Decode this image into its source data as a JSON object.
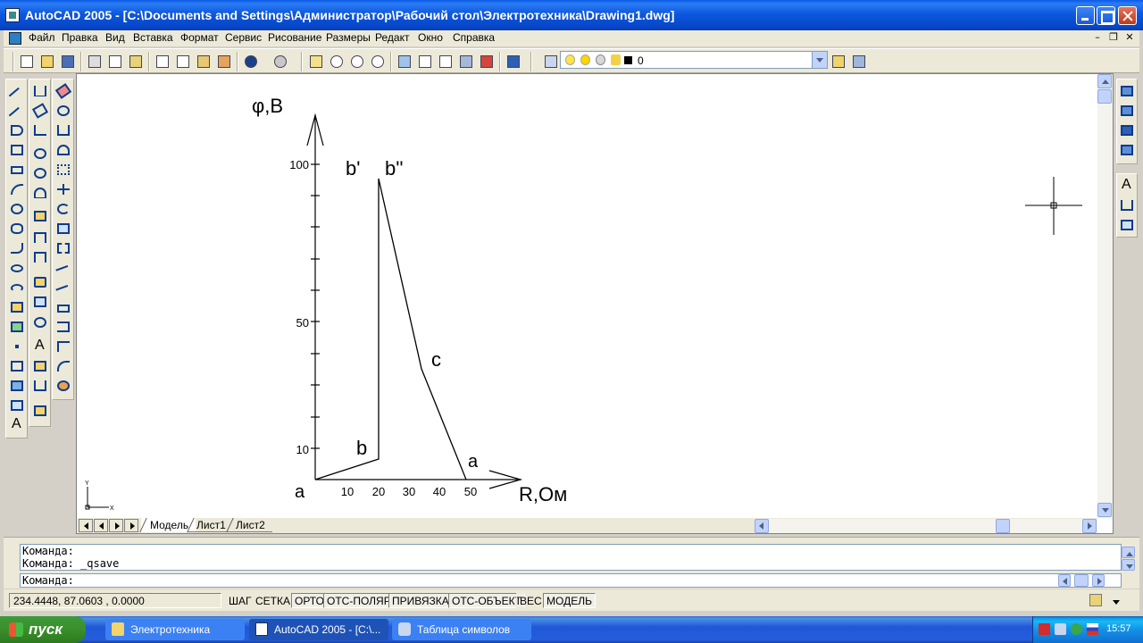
{
  "window": {
    "title": "AutoCAD 2005 - [C:\\Documents and Settings\\Администратор\\Рабочий стол\\Электротехника\\Drawing1.dwg]"
  },
  "menu": [
    "Файл",
    "Правка",
    "Вид",
    "Вставка",
    "Формат",
    "Сервис",
    "Рисование",
    "Размеры",
    "Редакт",
    "Окно",
    "Справка"
  ],
  "layer": {
    "current": "0"
  },
  "drawing": {
    "y_axis_label": "φ,B",
    "x_axis_label": "R,Ом",
    "y_ticks": [
      "100",
      "50",
      "10"
    ],
    "x_ticks": [
      "10",
      "20",
      "30",
      "40",
      "50"
    ],
    "origin_label": "a",
    "point_labels": [
      "b'",
      "b''",
      "c",
      "b",
      "a"
    ],
    "ucs": {
      "y": "Y",
      "x": "X"
    }
  },
  "tabs": [
    "Модель",
    "Лист1",
    "Лист2"
  ],
  "command": {
    "history": [
      "Команда:",
      "Команда: _qsave"
    ],
    "prompt": "Команда:"
  },
  "status": {
    "coords": "234.4448, 87.0603 , 0.0000",
    "toggles": [
      "ШАГ",
      "СЕТКА",
      "ОРТО",
      "ОТС-ПОЛЯР",
      "ПРИВЯЗКА",
      "ОТС-ОБЪЕКТ",
      "ВЕС",
      "МОДЕЛЬ"
    ]
  },
  "taskbar": {
    "start": "пуск",
    "tasks": [
      "Электротехника",
      "AutoCAD 2005 - [C:\\...",
      "Таблица символов"
    ],
    "clock": "15:57"
  },
  "colors": {
    "title_blue": "#0a5ae8",
    "canvas": "#ffffff",
    "taskbar_blue": "#245edb",
    "start_green": "#3a8f2a"
  }
}
